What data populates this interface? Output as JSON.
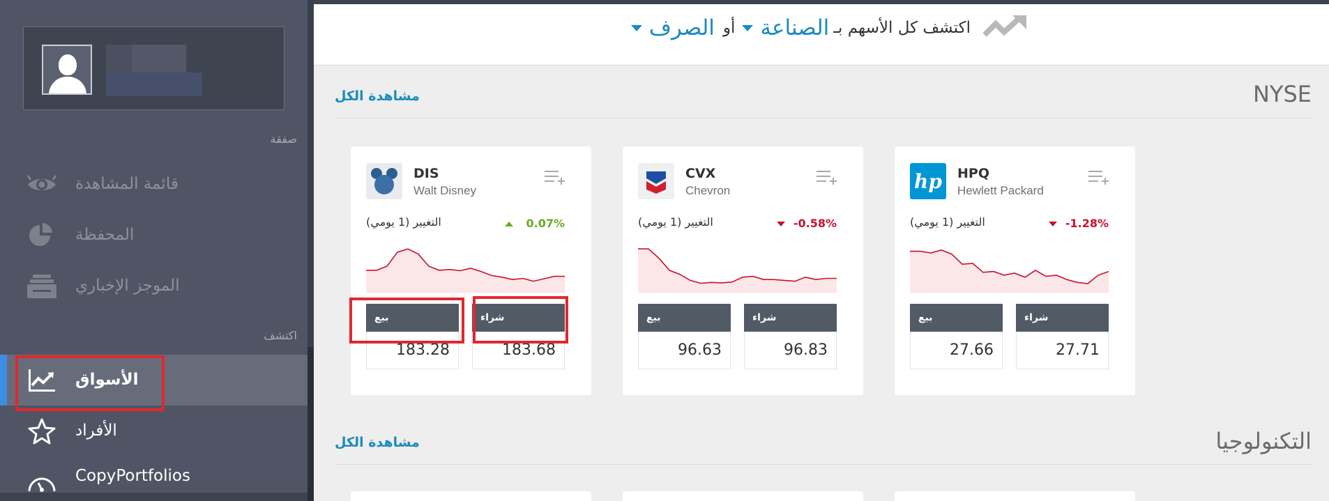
{
  "sidebar": {
    "sections": {
      "trade": "صفقة",
      "discover": "اكتشف"
    },
    "items": [
      {
        "label": "قائمة المشاهدة",
        "icon": "eye-icon"
      },
      {
        "label": "المحفظة",
        "icon": "pie-chart-icon"
      },
      {
        "label": "الموجز الإخباري",
        "icon": "news-feed-icon"
      },
      {
        "label": "الأسواق",
        "icon": "trending-up-icon",
        "active": true
      },
      {
        "label": "الأفراد",
        "icon": "star-icon"
      },
      {
        "label": "CopyPortfolios",
        "icon": "gauge-icon"
      }
    ]
  },
  "header": {
    "prefix": "اكتشف كل الأسهم بـ",
    "industry_link": "الصناعة",
    "or_text": "أو",
    "exchange_link": "الصرف"
  },
  "sections": [
    {
      "title": "NYSE",
      "view_all": "مشاهدة الكل"
    },
    {
      "title": "التكنولوجيا",
      "view_all": "مشاهدة الكل"
    }
  ],
  "cards": [
    {
      "ticker": "DIS",
      "company": "Walt Disney",
      "change_label": "التغيير (1 يومي)",
      "change": "0.07%",
      "direction": "up",
      "sell_label": "بيع",
      "buy_label": "شراء",
      "sell_price": "183.28",
      "buy_price": "183.68",
      "logo": "mickey-logo-icon",
      "spark": [
        0.45,
        0.45,
        0.55,
        0.9,
        0.98,
        0.85,
        0.55,
        0.45,
        0.47,
        0.44,
        0.5,
        0.42,
        0.32,
        0.28,
        0.22,
        0.25,
        0.18,
        0.24,
        0.3,
        0.3
      ]
    },
    {
      "ticker": "CVX",
      "company": "Chevron",
      "change_label": "التغيير (1 يومي)",
      "change": "-0.58%",
      "direction": "down",
      "sell_label": "بيع",
      "buy_label": "شراء",
      "sell_price": "96.63",
      "buy_price": "96.83",
      "logo": "chevron-logo-icon",
      "spark": [
        0.98,
        0.98,
        0.75,
        0.45,
        0.35,
        0.2,
        0.13,
        0.15,
        0.14,
        0.16,
        0.28,
        0.3,
        0.22,
        0.22,
        0.2,
        0.18,
        0.28,
        0.22,
        0.25,
        0.25
      ]
    },
    {
      "ticker": "HPQ",
      "company": "Hewlett Packard",
      "change_label": "التغيير (1 يومي)",
      "change": "-1.28%",
      "direction": "down",
      "sell_label": "بيع",
      "buy_label": "شراء",
      "sell_price": "27.66",
      "buy_price": "27.71",
      "logo": "hp-logo-icon",
      "spark": [
        0.92,
        0.92,
        0.88,
        0.95,
        0.85,
        0.6,
        0.62,
        0.4,
        0.42,
        0.33,
        0.38,
        0.28,
        0.45,
        0.3,
        0.33,
        0.22,
        0.15,
        0.12,
        0.33,
        0.42
      ]
    }
  ],
  "colors": {
    "accent": "#1b8bbd",
    "up": "#6aaa25",
    "down": "#c8102e",
    "sidebar_bg": "#4f5564",
    "highlight": "#e0282f"
  }
}
